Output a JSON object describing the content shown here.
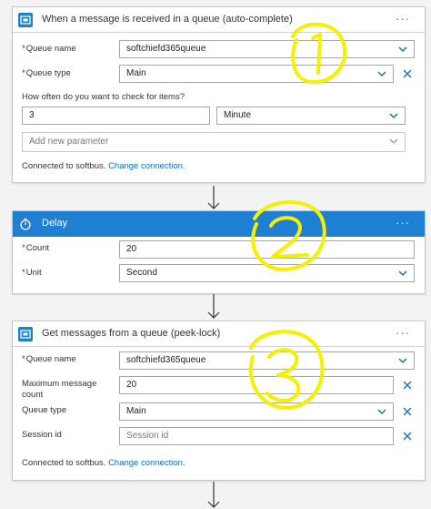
{
  "card1": {
    "title": "When a message is received in a queue (auto-complete)",
    "more": "···",
    "queue_name": {
      "label": "Queue name",
      "value": "softchiefd365queue"
    },
    "queue_type": {
      "label": "Queue type",
      "value": "Main"
    },
    "interval_prompt": "How often do you want to check for items?",
    "interval_value": "3",
    "interval_unit": "Minute",
    "add_param_placeholder": "Add new parameter",
    "connected_text": "Connected to softbus.",
    "change_connection": "Change connection."
  },
  "card2": {
    "title": "Delay",
    "more": "···",
    "count": {
      "label": "Count",
      "value": "20"
    },
    "unit": {
      "label": "Unit",
      "value": "Second"
    }
  },
  "card3": {
    "title": "Get messages from a queue (peek-lock)",
    "more": "···",
    "queue_name": {
      "label": "Queue name",
      "value": "softchiefd365queue"
    },
    "max_count": {
      "label_line1": "Maximum message",
      "label_line2": "count",
      "value": "20"
    },
    "queue_type": {
      "label": "Queue type",
      "value": "Main"
    },
    "session_id": {
      "label": "Session id",
      "placeholder": "Session id"
    },
    "connected_text": "Connected to softbus.",
    "change_connection": "Change connection."
  },
  "required_marker": "*",
  "colors": {
    "header_blue": "#1f7fd0",
    "icon_blue": "#1e84c6",
    "link": "#0f6cbd",
    "annotation_yellow": "#f5f000"
  }
}
